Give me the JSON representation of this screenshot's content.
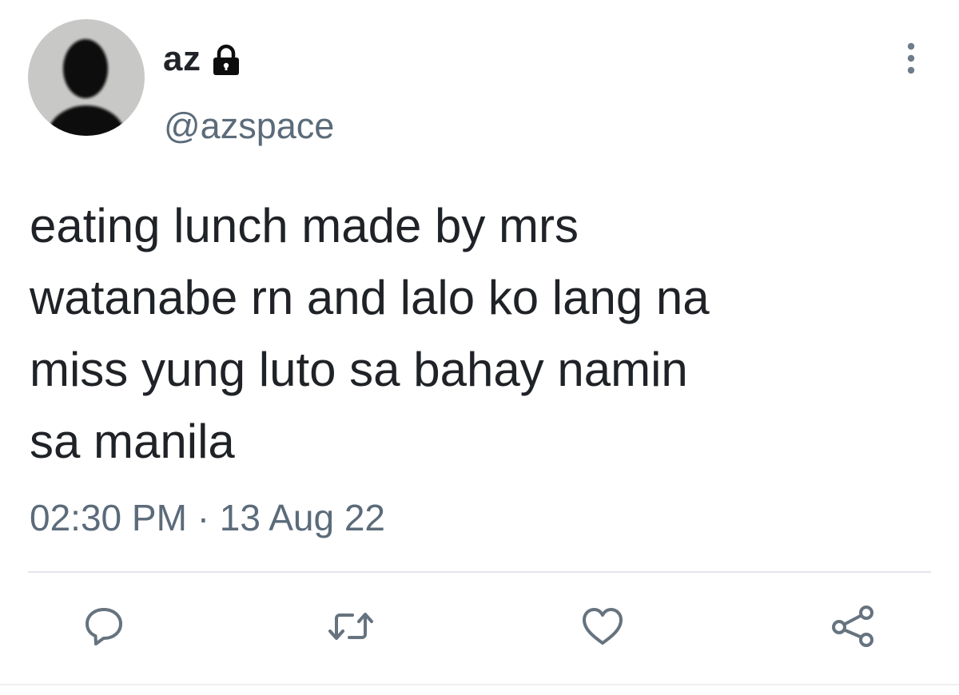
{
  "user": {
    "display_name": "az",
    "handle": "@azspace",
    "protected_icon": "lock-icon",
    "avatar_icon": "default-avatar-silhouette"
  },
  "tweet": {
    "lines": [
      "eating lunch made by mrs",
      "watanabe rn and lalo ko lang na",
      "miss yung luto sa bahay namin",
      "sa manila"
    ],
    "time": "02:30 PM",
    "separator": "·",
    "date": "13 Aug 22"
  },
  "actions": [
    {
      "name": "reply",
      "icon": "comment-icon"
    },
    {
      "name": "retweet",
      "icon": "retweet-icon"
    },
    {
      "name": "like",
      "icon": "heart-icon"
    },
    {
      "name": "share",
      "icon": "share-icon"
    }
  ],
  "menu": {
    "icon": "more-vertical-icon"
  },
  "colors": {
    "text": "#1f2226",
    "muted": "#5b6b7a",
    "divider": "#e3e6e9",
    "avatar_bg": "#c8c9c6"
  }
}
